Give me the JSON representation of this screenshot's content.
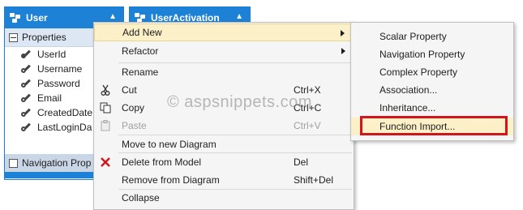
{
  "entities": {
    "user": {
      "title": "User",
      "properties_label": "Properties",
      "properties": [
        "UserId",
        "Username",
        "Password",
        "Email",
        "CreatedDate",
        "LastLoginDa"
      ],
      "nav_label": "Navigation Prop"
    },
    "user_activation": {
      "title": "UserActivation"
    }
  },
  "context_menu": {
    "items": [
      {
        "label": "Add New",
        "shortcut": "",
        "submenu": true
      },
      {
        "label": "Refactor",
        "shortcut": "",
        "submenu": true
      },
      {
        "label": "Rename",
        "shortcut": ""
      },
      {
        "label": "Cut",
        "shortcut": "Ctrl+X",
        "icon": "scissors-icon"
      },
      {
        "label": "Copy",
        "shortcut": "Ctrl+C",
        "icon": "copy-icon"
      },
      {
        "label": "Paste",
        "shortcut": "Ctrl+V",
        "icon": "paste-icon",
        "disabled": true
      },
      {
        "label": "Move to new Diagram",
        "shortcut": ""
      },
      {
        "label": "Delete from Model",
        "shortcut": "Del",
        "icon": "delete-icon"
      },
      {
        "label": "Remove from Diagram",
        "shortcut": "Shift+Del"
      },
      {
        "label": "Collapse",
        "shortcut": ""
      }
    ]
  },
  "submenu": {
    "items": [
      "Scalar Property",
      "Navigation Property",
      "Complex Property",
      "Association...",
      "Inheritance...",
      "Function Import..."
    ]
  },
  "watermark": "© aspsnippets.com",
  "colors": {
    "header": "#1d82d6",
    "highlight": "#fbf0c8",
    "red_box": "#d4141b",
    "delete": "#d4141b"
  }
}
